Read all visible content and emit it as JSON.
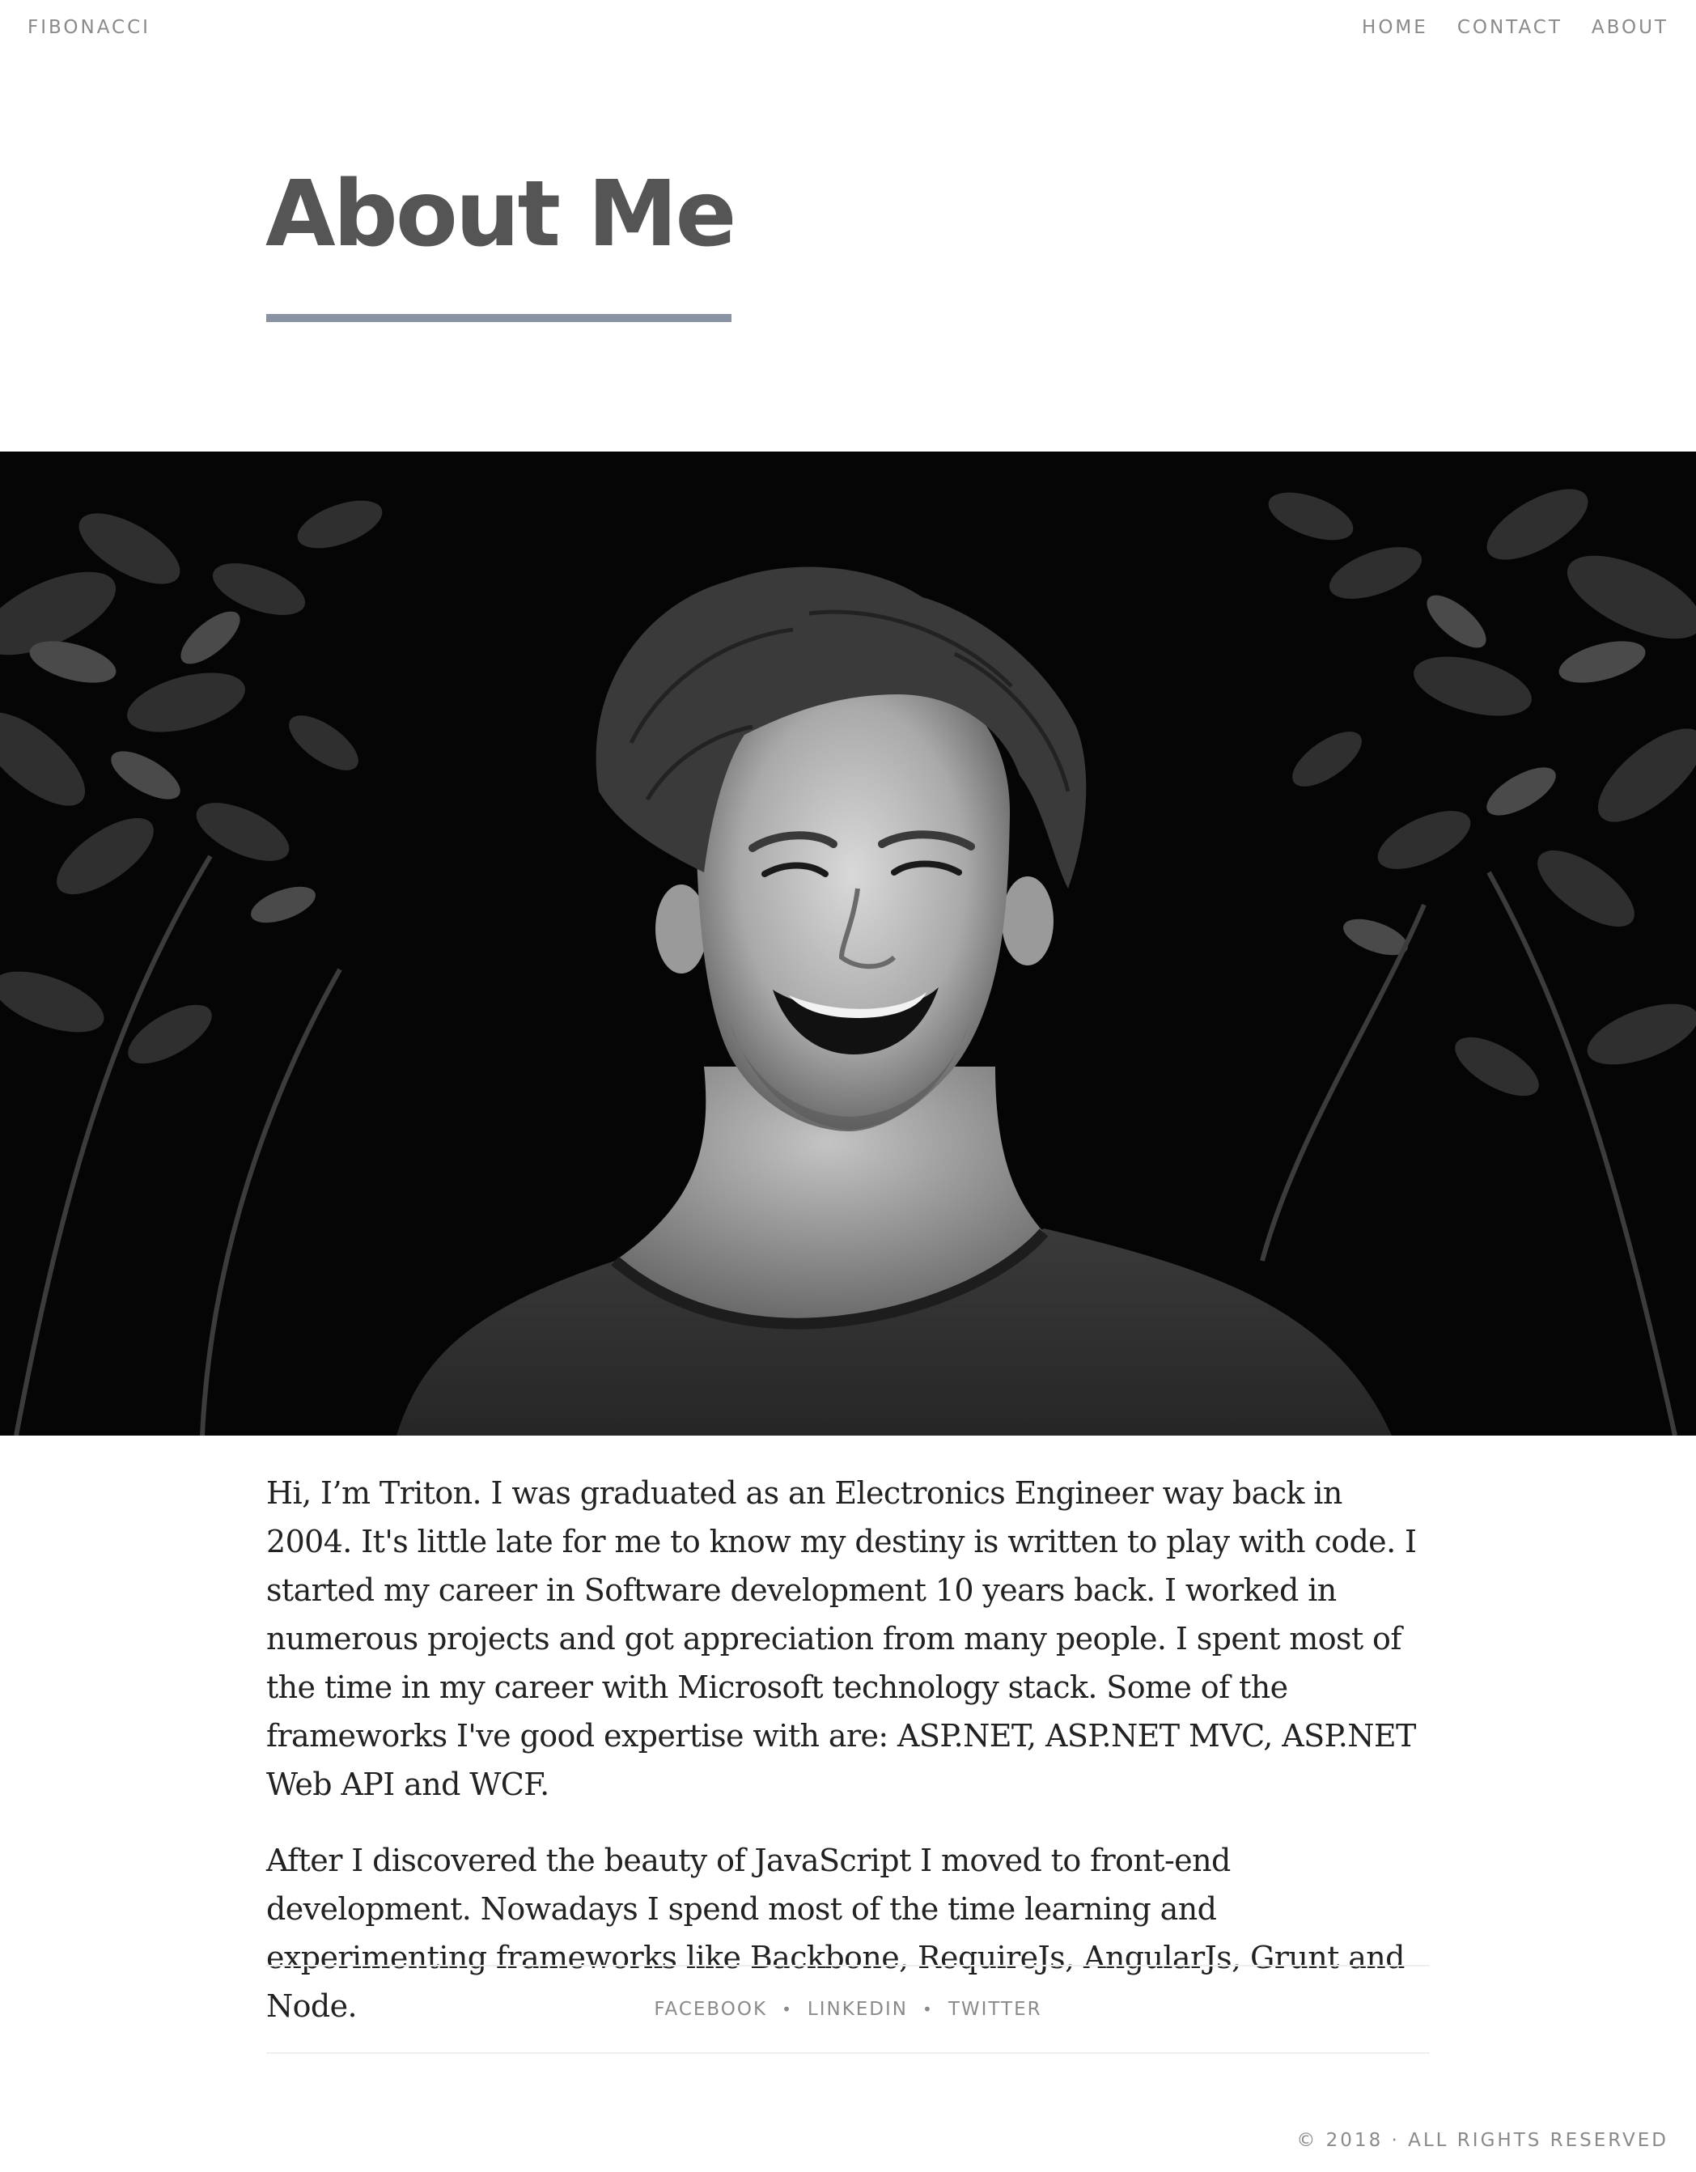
{
  "header": {
    "brand": "FIBONACCI",
    "nav": [
      "HOME",
      "CONTACT",
      "ABOUT"
    ]
  },
  "main": {
    "title": "About Me",
    "hero_image_alt": "portrait-photo",
    "bio": [
      "Hi, I’m Triton. I was graduated as an Electronics Engineer way back in 2004. It's little late for me to know my destiny is written to play with code. I started my career in Software development 10 years back. I worked in numerous projects and got appreciation from many people. I spent most of the time in my career with Microsoft technology stack. Some of the frameworks I've good expertise with are: ASP.NET, ASP.NET MVC, ASP.NET Web API and WCF.",
      "After I discovered the beauty of JavaScript I moved to front-end development. Nowadays I spend most of the time learning and experimenting frameworks like Backbone, RequireJs, AngularJs, Grunt and Node."
    ]
  },
  "social": {
    "links": [
      "FACEBOOK",
      "LINKEDIN",
      "TWITTER"
    ],
    "separator": "•"
  },
  "footer": {
    "copyright": "© 2018 · ALL RIGHTS RESERVED"
  },
  "colors": {
    "accent_rule": "#8a93a3",
    "nav_text": "#8a8a8a",
    "title_text": "#555555",
    "body_text": "#222222"
  }
}
